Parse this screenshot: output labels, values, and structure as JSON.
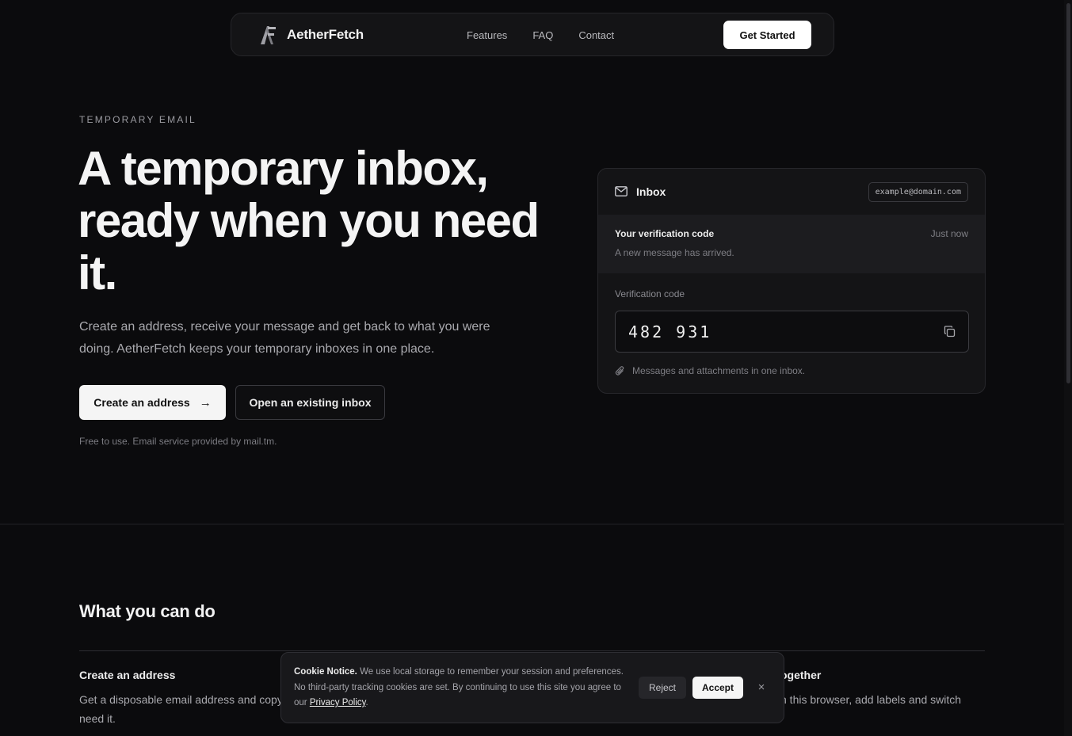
{
  "nav": {
    "brand_name": "AetherFetch",
    "links": [
      "Features",
      "FAQ",
      "Contact"
    ],
    "cta_label": "Get Started"
  },
  "hero": {
    "eyebrow": "TEMPORARY EMAIL",
    "title": "A temporary inbox, ready when you need it.",
    "description": "Create an address, receive your message and get back to what you were doing. AetherFetch keeps your temporary inboxes in one place.",
    "primary_cta": "Create an address",
    "secondary_cta": "Open an existing inbox",
    "note": "Free to use. Email service provided by mail.tm."
  },
  "inbox_card": {
    "title": "Inbox",
    "address": "example@domain.com",
    "message": {
      "subject": "Your verification code",
      "time": "Just now",
      "preview": "A new message has arrived."
    },
    "code_label": "Verification code",
    "code_value": "482 931",
    "footer_note": "Messages and attachments in one inbox."
  },
  "features": {
    "title": "What you can do",
    "items": [
      {
        "title": "Create an address",
        "description": "Get a disposable email address and copy need it."
      },
      {
        "title": "ogether",
        "description": "n this browser, add labels and switch"
      }
    ]
  },
  "cookie": {
    "title": "Cookie Notice.",
    "body": " We use local storage to remember your session and preferences. No third-party tracking cookies are set. By continuing to use this site you agree to our ",
    "link_text": "Privacy Policy",
    "suffix": ".",
    "reject_label": "Reject",
    "accept_label": "Accept",
    "close_glyph": "×"
  },
  "icons": {
    "brand": "af-logo-icon",
    "inbox": "mail-icon",
    "copy": "copy-icon",
    "attachment": "paperclip-icon",
    "arrow": "arrow-right-icon",
    "close": "close-icon"
  },
  "colors": {
    "background": "#0b0b0d",
    "card": "#141416",
    "accent_button": "#ffffff",
    "muted_text": "#a9a9ae"
  }
}
